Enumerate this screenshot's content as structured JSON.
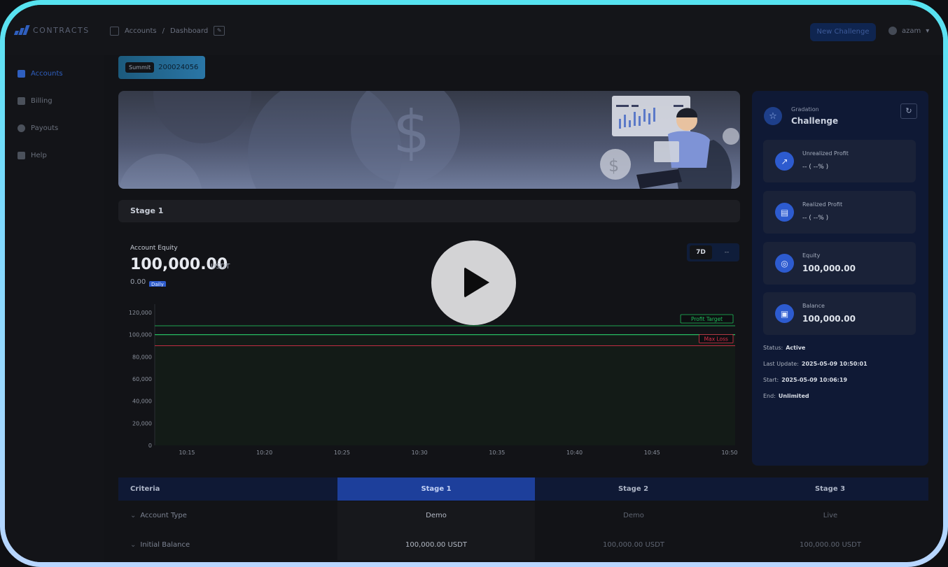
{
  "app": {
    "logo_text": "CONTRACTS"
  },
  "topbar": {
    "breadcrumb": [
      "Accounts",
      "Dashboard"
    ],
    "new_challenge_label": "New Challenge",
    "user_name": "azam"
  },
  "sidebar": {
    "items": [
      {
        "label": "Accounts",
        "icon": "grid-icon",
        "active": true
      },
      {
        "label": "Billing",
        "icon": "document-icon",
        "active": false
      },
      {
        "label": "Payouts",
        "icon": "payout-icon",
        "active": false
      },
      {
        "label": "Help",
        "icon": "help-icon",
        "active": false
      }
    ]
  },
  "account": {
    "tag": "Summit",
    "id": "200024056"
  },
  "stage_title": "Stage 1",
  "equity_panel": {
    "label": "Account Equity",
    "value": "100,000.00",
    "unit": "USDT",
    "change": "0.00",
    "daily_badge": "Daily",
    "range_selected": "7D",
    "range_other": "--"
  },
  "chart_data": {
    "type": "line",
    "x": [
      "10:15",
      "10:20",
      "10:25",
      "10:30",
      "10:35",
      "10:40",
      "10:45",
      "10:50"
    ],
    "y_ticks": [
      "120,000",
      "100,000",
      "80,000",
      "60,000",
      "40,000",
      "20,000",
      "0"
    ],
    "ylim": [
      0,
      120000
    ],
    "series": [],
    "reference_lines": [
      {
        "name": "Profit Target",
        "value": 108000,
        "color": "#1fbf5a"
      },
      {
        "name": "Max Loss",
        "value": 90000,
        "color": "#e0304a"
      }
    ],
    "equity_line_value": 100000,
    "equity_line_color": "#2ad06a",
    "grid": false
  },
  "right_panel": {
    "gradation_label": "Gradation",
    "gradation_value": "Challenge",
    "metrics": [
      {
        "label": "Unrealized Profit",
        "value": "--  ( --% )",
        "icon": "chart-icon"
      },
      {
        "label": "Realized Profit",
        "value": "--  ( --% )",
        "icon": "wallet-icon"
      },
      {
        "label": "Equity",
        "value": "100,000.00",
        "icon": "target-icon"
      },
      {
        "label": "Balance",
        "value": "100,000.00",
        "icon": "card-icon"
      }
    ],
    "status_label": "Status:",
    "status_value": "Active",
    "last_update_label": "Last Update:",
    "last_update_value": "2025-05-09 10:50:01",
    "start_label": "Start:",
    "start_value": "2025-05-09 10:06:19",
    "end_label": "End:",
    "end_value": "Unlimited"
  },
  "criteria_table": {
    "headers": [
      "Criteria",
      "Stage 1",
      "Stage 2",
      "Stage 3"
    ],
    "rows": [
      {
        "label": "Account Type",
        "values": [
          "Demo",
          "Demo",
          "Live"
        ]
      },
      {
        "label": "Initial Balance",
        "values": [
          "100,000.00 USDT",
          "100,000.00 USDT",
          "100,000.00 USDT"
        ]
      }
    ]
  },
  "colors": {
    "accent": "#2f5fbf",
    "panel": "#0f1935",
    "profit": "#1fbf5a",
    "loss": "#e0304a"
  }
}
